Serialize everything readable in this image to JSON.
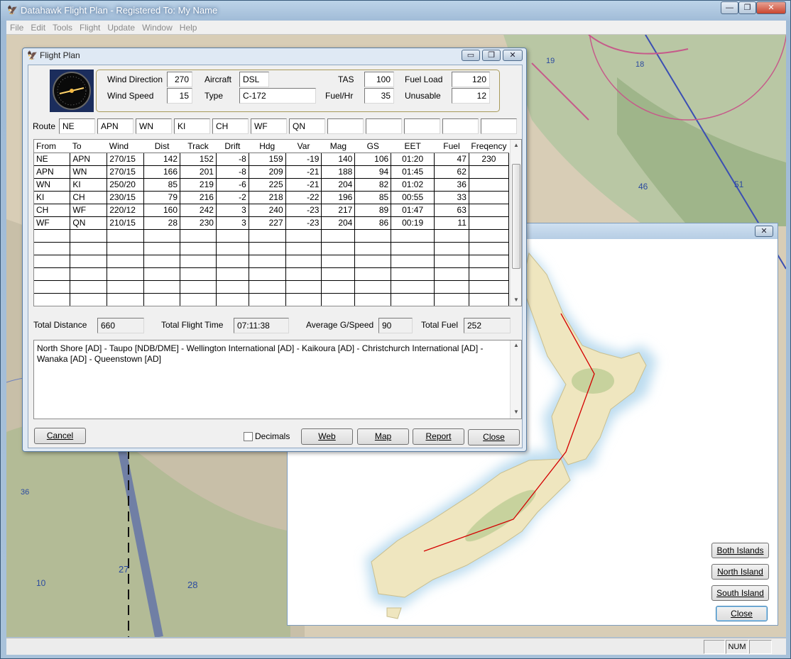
{
  "app": {
    "title": "Datahawk Flight Plan - Registered To: My Name",
    "caption_buttons": [
      "—",
      "❐",
      "✕"
    ]
  },
  "menu": [
    "File",
    "Edit",
    "Tools",
    "Flight",
    "Update",
    "Window",
    "Help"
  ],
  "status": {
    "num": "NUM"
  },
  "flight_plan": {
    "title": "Flight Plan",
    "caption_buttons": [
      "▭",
      "❐",
      "✕"
    ],
    "params": {
      "wind_direction_label": "Wind Direction",
      "wind_direction": "270",
      "wind_speed_label": "Wind Speed",
      "wind_speed": "15",
      "aircraft_label": "Aircraft",
      "aircraft": "DSL",
      "type_label": "Type",
      "type": "C-172",
      "tas_label": "TAS",
      "tas": "100",
      "fuel_hr_label": "Fuel/Hr",
      "fuel_hr": "35",
      "fuel_load_label": "Fuel Load",
      "fuel_load": "120",
      "unusable_label": "Unusable",
      "unusable": "12"
    },
    "route_label": "Route",
    "route": [
      "NE",
      "APN",
      "WN",
      "KI",
      "CH",
      "WF",
      "QN",
      "",
      "",
      "",
      "",
      ""
    ],
    "columns": [
      "From",
      "To",
      "Wind",
      "Dist",
      "Track",
      "Drift",
      "Hdg",
      "Var",
      "Mag",
      "GS",
      "EET",
      "Fuel",
      "Freqency"
    ],
    "legs": [
      [
        "NE",
        "APN",
        "270/15",
        "142",
        "152",
        "-8",
        "159",
        "-19",
        "140",
        "106",
        "01:20",
        "47",
        "230"
      ],
      [
        "APN",
        "WN",
        "270/15",
        "166",
        "201",
        "-8",
        "209",
        "-21",
        "188",
        "94",
        "01:45",
        "62",
        ""
      ],
      [
        "WN",
        "KI",
        "250/20",
        "85",
        "219",
        "-6",
        "225",
        "-21",
        "204",
        "82",
        "01:02",
        "36",
        ""
      ],
      [
        "KI",
        "CH",
        "230/15",
        "79",
        "216",
        "-2",
        "218",
        "-22",
        "196",
        "85",
        "00:55",
        "33",
        ""
      ],
      [
        "CH",
        "WF",
        "220/12",
        "160",
        "242",
        "3",
        "240",
        "-23",
        "217",
        "89",
        "01:47",
        "63",
        ""
      ],
      [
        "WF",
        "QN",
        "210/15",
        "28",
        "230",
        "3",
        "227",
        "-23",
        "204",
        "86",
        "00:19",
        "11",
        ""
      ]
    ],
    "empty_row_count": 6,
    "totals": {
      "distance_label": "Total Distance",
      "distance": "660",
      "time_label": "Total Flight Time",
      "time": "07:11:38",
      "gspeed_label": "Average G/Speed",
      "gspeed": "90",
      "fuel_label": "Total Fuel",
      "fuel": "252"
    },
    "route_text": "North Shore [AD] - Taupo [NDB/DME] - Wellington International [AD] - Kaikoura [AD] - Christchurch International [AD] - Wanaka [AD] - Queenstown [AD]",
    "buttons": {
      "cancel": "Cancel",
      "decimals": "Decimals",
      "web": "Web",
      "map": "Map",
      "report": "Report",
      "close": "Close"
    }
  },
  "map_window": {
    "close_glyph": "✕",
    "buttons": {
      "both": "Both Islands",
      "north": "North Island",
      "south": "South Island",
      "close": "Close"
    }
  },
  "colors": {
    "route_line": "#d40000",
    "land": "#efe6bf",
    "sea_shallow": "#bcdcef",
    "titlebar": "#a9c2da"
  }
}
